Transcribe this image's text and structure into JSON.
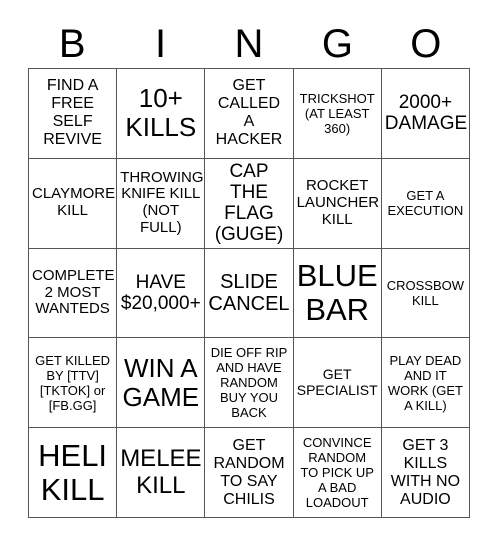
{
  "card": {
    "header_letters": [
      "B",
      "I",
      "N",
      "G",
      "O"
    ],
    "rows": [
      [
        {
          "text": "FIND A\nFREE\nSELF\nREVIVE",
          "size": "md"
        },
        {
          "text": "10+\nKILLS",
          "size": "xl"
        },
        {
          "text": "GET\nCALLED\nA\nHACKER",
          "size": "md"
        },
        {
          "text": "TRICKSHOT\n(AT LEAST\n360)",
          "size": "sm"
        },
        {
          "text": "2000+\nDAMAGE",
          "size": "lg"
        }
      ],
      [
        {
          "text": "CLAYMORE\nKILL",
          "size": "md"
        },
        {
          "text": "THROWING\nKNIFE KILL\n(NOT FULL)",
          "size": "md"
        },
        {
          "text": "CAP THE\nFLAG\n(GUGE)",
          "size": "lg"
        },
        {
          "text": "ROCKET\nLAUNCHER\nKILL",
          "size": "md"
        },
        {
          "text": "GET A\nEXECUTION",
          "size": "sm"
        }
      ],
      [
        {
          "text": "COMPLETE\n2 MOST\nWANTEDS",
          "size": "md"
        },
        {
          "text": "HAVE\n$20,000+",
          "size": "lg"
        },
        {
          "text": "SLIDE\nCANCEL",
          "size": "lg"
        },
        {
          "text": "BLUE\nBAR",
          "size": "xxl"
        },
        {
          "text": "CROSSBOW\nKILL",
          "size": "sm"
        }
      ],
      [
        {
          "text": "GET KILLED\nBY [TTV]\n[TKTOK] or\n[FB.GG]",
          "size": "sm"
        },
        {
          "text": "WIN A\nGAME",
          "size": "xl"
        },
        {
          "text": "DIE OFF RIP\nAND HAVE\nRANDOM\nBUY YOU\nBACK",
          "size": "sm"
        },
        {
          "text": "GET\nSPECIALIST",
          "size": "md"
        },
        {
          "text": "PLAY DEAD\nAND IT\nWORK (GET\nA KILL)",
          "size": "sm"
        }
      ],
      [
        {
          "text": "HELI\nKILL",
          "size": "xxl"
        },
        {
          "text": "MELEE\nKILL",
          "size": "xl"
        },
        {
          "text": "GET\nRANDOM\nTO SAY\nCHILIS",
          "size": "md"
        },
        {
          "text": "CONVINCE\nRANDOM\nTO PICK UP\nA BAD\nLOADOUT",
          "size": "sm"
        },
        {
          "text": "GET 3\nKILLS\nWITH NO\nAUDIO",
          "size": "md"
        }
      ]
    ],
    "colors": {
      "background": "#ffffff",
      "text": "#000000",
      "grid_line": "#555555"
    }
  }
}
